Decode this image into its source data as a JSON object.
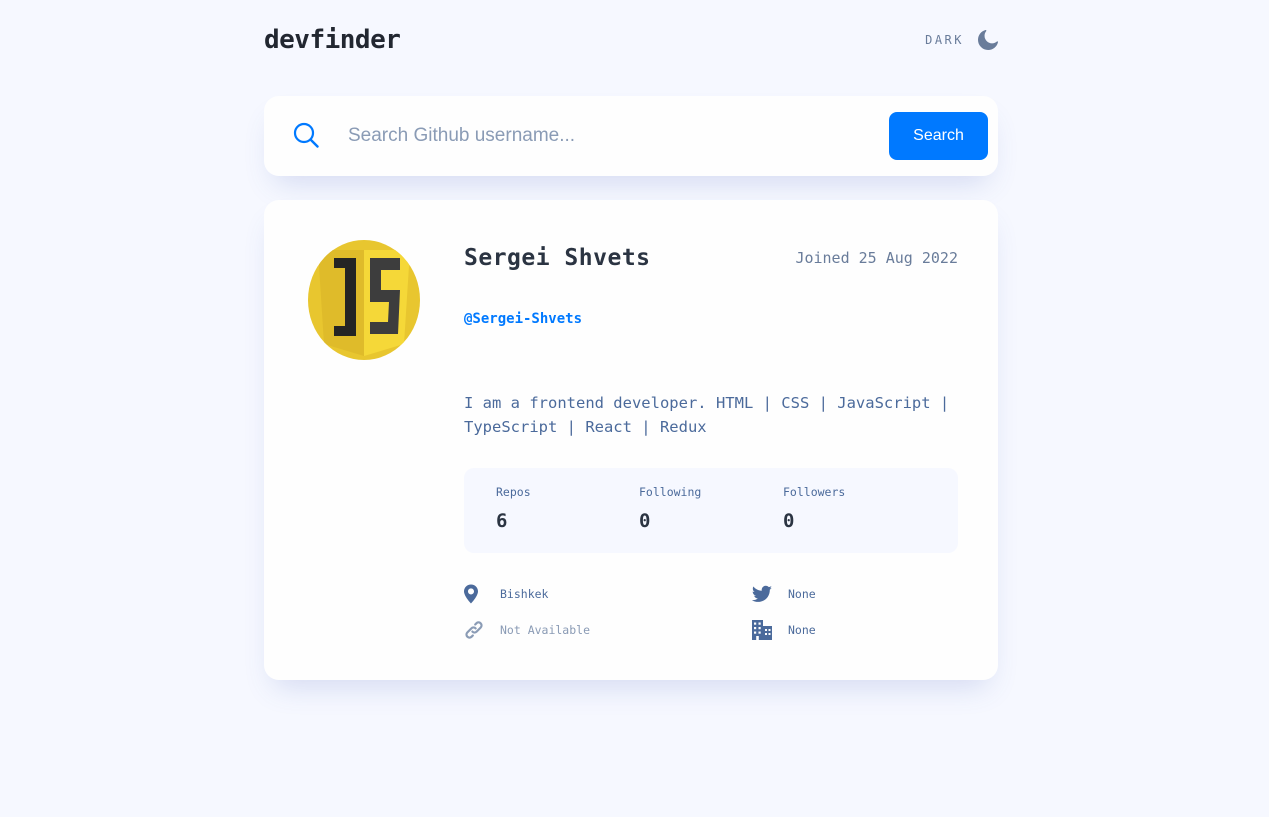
{
  "header": {
    "logo": "devfinder",
    "theme_label": "DARK",
    "theme_icon": "moon-icon"
  },
  "search": {
    "placeholder": "Search Github username...",
    "button_label": "Search",
    "icon": "search-icon"
  },
  "profile": {
    "name": "Sergei Shvets",
    "joined": "Joined 25 Aug 2022",
    "login": "@Sergei-Shvets",
    "bio": "I am a frontend developer. HTML | CSS | JavaScript | TypeScript | React | Redux",
    "avatar": "javascript-logo"
  },
  "stats": [
    {
      "label": "Repos",
      "value": "6"
    },
    {
      "label": "Following",
      "value": "0"
    },
    {
      "label": "Followers",
      "value": "0"
    }
  ],
  "info": {
    "location": "Bishkek",
    "blog": "Not Available",
    "twitter": "None",
    "company": "None"
  },
  "colors": {
    "accent": "#0079ff",
    "background": "#f6f8ff",
    "card": "#fefefe",
    "heading": "#2b3442",
    "text": "#4b6a9b",
    "muted": "#697c9a"
  }
}
